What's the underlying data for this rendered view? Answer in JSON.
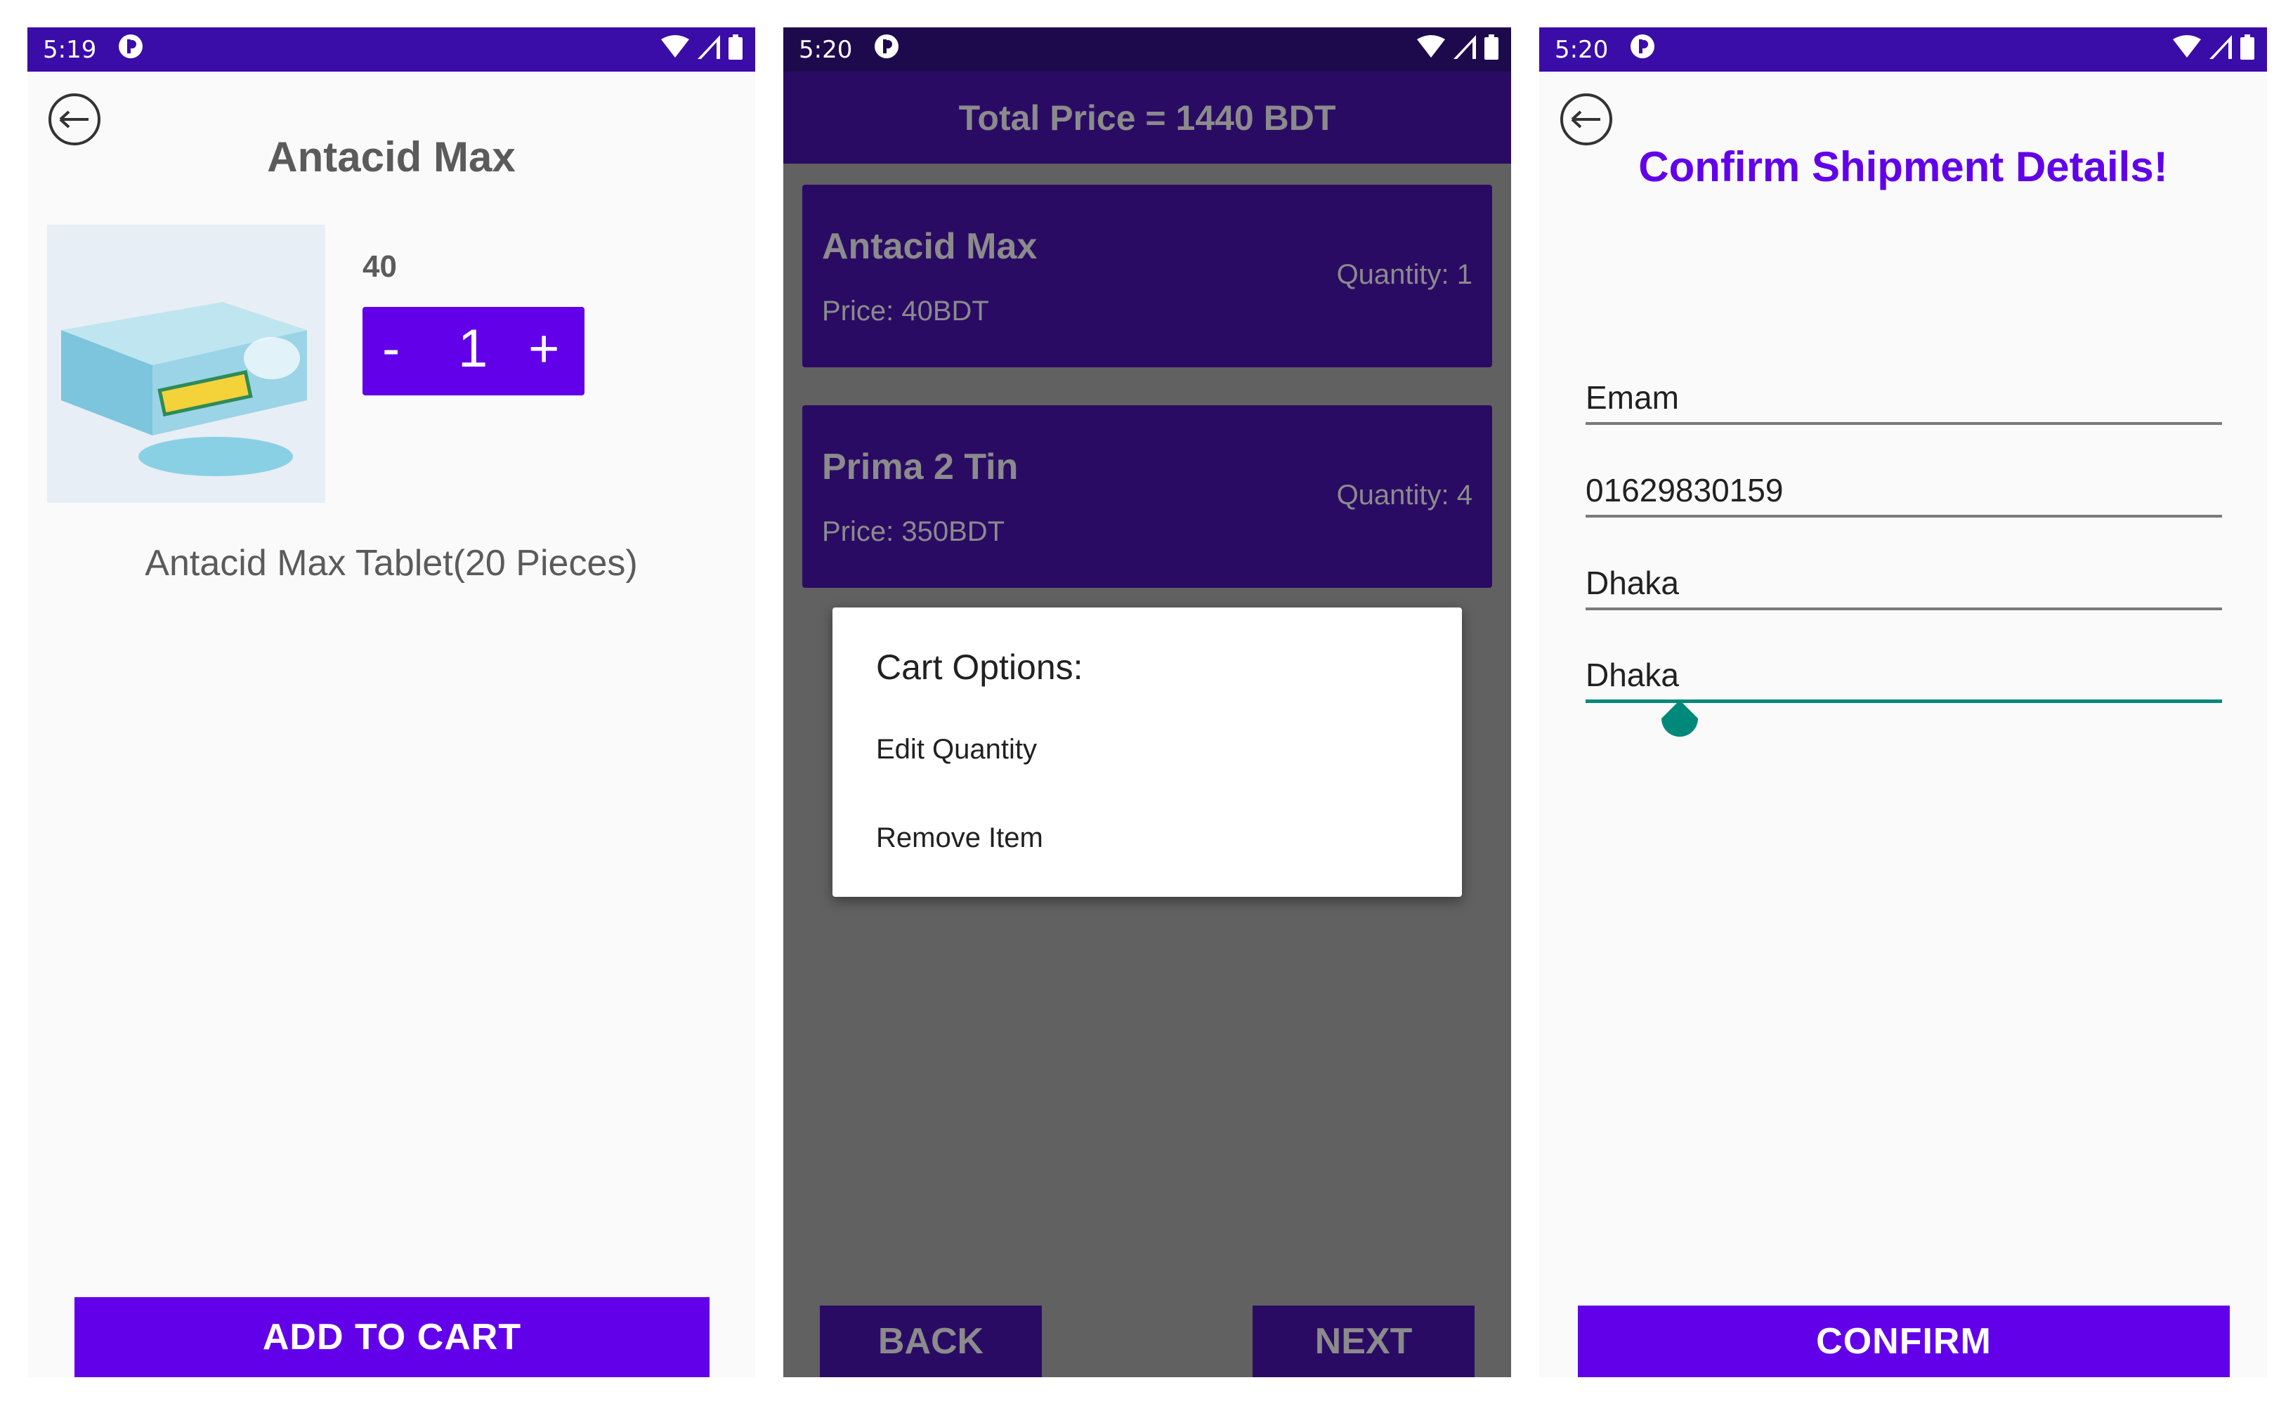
{
  "screens": [
    {
      "status_time": "5:19",
      "title": "Antacid Max",
      "price": "40",
      "stepper": {
        "minus": "-",
        "value": "1",
        "plus": "+"
      },
      "description": "Antacid Max Tablet(20 Pieces)",
      "add_to_cart": "ADD TO CART",
      "icons": {
        "back": "arrow-left-icon",
        "product": "product-image"
      }
    },
    {
      "status_time": "5:20",
      "total_price": "Total Price = 1440 BDT",
      "cart_items": [
        {
          "name": "Antacid Max",
          "price": "Price: 40BDT",
          "quantity": "Quantity: 1"
        },
        {
          "name": "Prima 2 Tin",
          "price": "Price: 350BDT",
          "quantity": "Quantity: 4"
        }
      ],
      "dialog": {
        "title": "Cart Options:",
        "options": [
          "Edit Quantity",
          "Remove Item"
        ]
      },
      "back": "BACK",
      "next": "NEXT"
    },
    {
      "status_time": "5:20",
      "title": "Confirm Shipment Details!",
      "fields": [
        "Emam",
        "01629830159",
        "Dhaka",
        "Dhaka"
      ],
      "confirm": "CONFIRM"
    }
  ],
  "colors": {
    "primary": "#6200ea",
    "status_bar": "#3a0ca8",
    "dark_overlay": "#616161",
    "accent": "#00897b"
  }
}
